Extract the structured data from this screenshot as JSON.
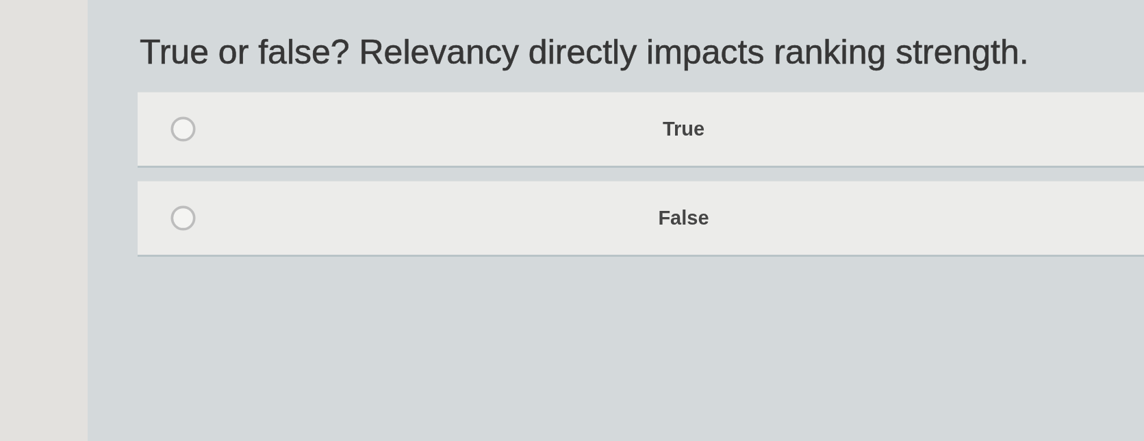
{
  "question": "True or false? Relevancy directly impacts ranking strength.",
  "options": [
    {
      "label": "True",
      "selected": false
    },
    {
      "label": "False",
      "selected": false
    }
  ]
}
